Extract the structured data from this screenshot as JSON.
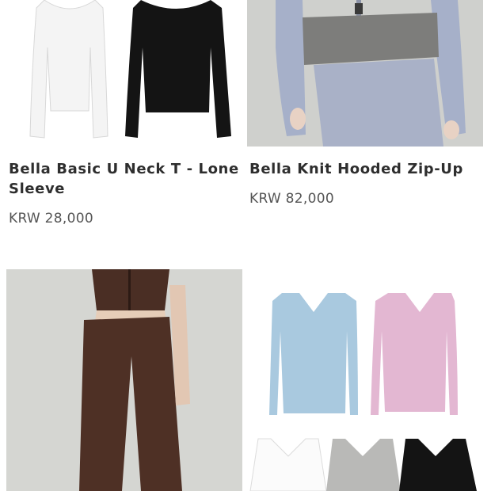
{
  "products": [
    {
      "name": "Bella Basic U Neck T - Lone Sleeve",
      "price": "KRW 28,000",
      "image": "white-and-black-u-neck-long-sleeve-tees"
    },
    {
      "name": "Bella Knit Hooded Zip-Up",
      "price": "KRW 82,000",
      "image": "lavender-knit-zip-up-with-grey-top"
    },
    {
      "image": "brown-knit-zip-up-and-wide-pants"
    },
    {
      "image": "v-neck-knit-tops-in-blue-pink-white-grey-black"
    }
  ],
  "colors": {
    "blue_top": "#a9c9df",
    "pink_top": "#e3b7d2",
    "brown_set": "#4e3025",
    "lavender_knit": "#a6b0c9",
    "grey_top": "#7d7d7b",
    "black": "#141414"
  }
}
